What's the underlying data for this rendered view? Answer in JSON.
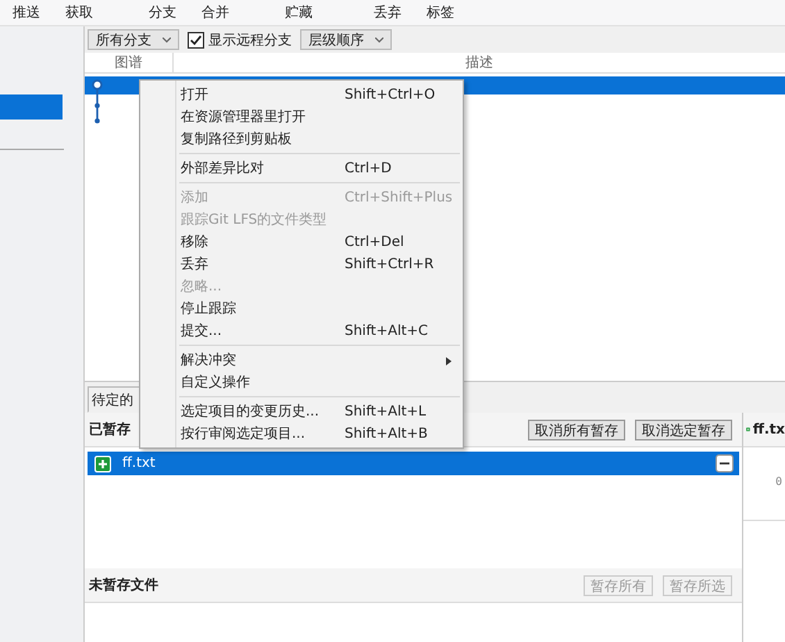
{
  "toolbar": [
    {
      "label": "推送"
    },
    {
      "label": "获取"
    },
    {
      "label": "分支"
    },
    {
      "label": "合并"
    },
    {
      "label": "贮藏"
    },
    {
      "label": "丢弃"
    },
    {
      "label": "标签"
    }
  ],
  "sidebar": {
    "items": [
      {
        "selected": true
      }
    ]
  },
  "filter_bar": {
    "branch_dropdown": "所有分支",
    "show_remote": {
      "label": "显示远程分支",
      "checked": true
    },
    "order_dropdown": "层级顺序"
  },
  "commit_table": {
    "columns": [
      "图谱",
      "描述"
    ],
    "rows": [
      {
        "selected": true
      }
    ]
  },
  "context_menu": [
    {
      "kind": "item",
      "label": "打开",
      "shortcut": "Shift+Ctrl+O",
      "disabled": false
    },
    {
      "kind": "item",
      "label": "在资源管理器里打开",
      "disabled": false
    },
    {
      "kind": "item",
      "label": "复制路径到剪贴板",
      "disabled": false
    },
    {
      "kind": "separator"
    },
    {
      "kind": "item",
      "label": "外部差异比对",
      "shortcut": "Ctrl+D",
      "disabled": false
    },
    {
      "kind": "separator"
    },
    {
      "kind": "item",
      "label": "添加",
      "shortcut": "Ctrl+Shift+Plus",
      "disabled": true
    },
    {
      "kind": "item",
      "label": "跟踪Git LFS的文件类型",
      "disabled": true
    },
    {
      "kind": "item",
      "label": "移除",
      "shortcut": "Ctrl+Del",
      "disabled": false
    },
    {
      "kind": "item",
      "label": "丢弃",
      "shortcut": "Shift+Ctrl+R",
      "disabled": false
    },
    {
      "kind": "item",
      "label": "忽略...",
      "disabled": true
    },
    {
      "kind": "item",
      "label": "停止跟踪",
      "disabled": false
    },
    {
      "kind": "item",
      "label": "提交...",
      "shortcut": "Shift+Alt+C",
      "disabled": false
    },
    {
      "kind": "separator"
    },
    {
      "kind": "submenu",
      "label": "解决冲突",
      "disabled": false
    },
    {
      "kind": "item",
      "label": "自定义操作",
      "disabled": false
    },
    {
      "kind": "separator"
    },
    {
      "kind": "item",
      "label": "选定项目的变更历史...",
      "shortcut": "Shift+Alt+L",
      "disabled": false
    },
    {
      "kind": "item",
      "label": "按行审阅选定项目...",
      "shortcut": "Shift+Alt+B",
      "disabled": false
    }
  ],
  "tabs": [
    {
      "label": "待定的",
      "selected": true
    }
  ],
  "staged": {
    "title": "已暂存",
    "buttons": [
      {
        "label": "取消所有暂存",
        "disabled": false
      },
      {
        "label": "取消选定暂存",
        "disabled": false
      }
    ],
    "files": [
      {
        "name": "ff.txt",
        "selected": true
      }
    ]
  },
  "unstaged": {
    "title": "未暂存文件",
    "buttons": [
      {
        "label": "暂存所有",
        "disabled": true
      },
      {
        "label": "暂存所选",
        "disabled": true
      }
    ]
  },
  "diff_panel": {
    "file": "ff.tx",
    "line_number": "0"
  }
}
